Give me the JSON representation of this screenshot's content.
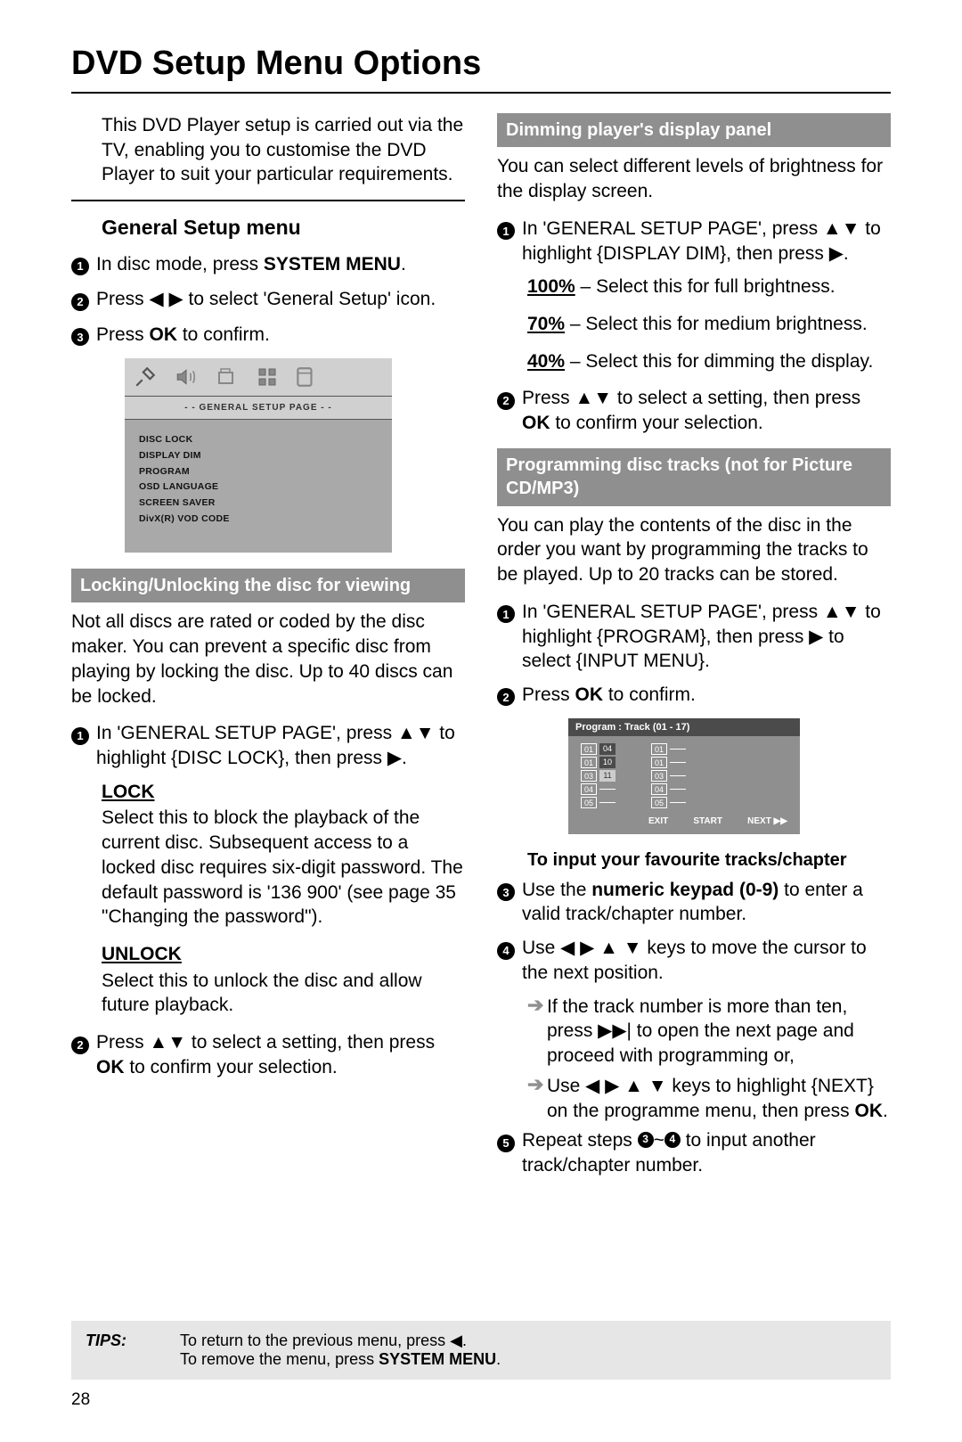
{
  "page_title": "DVD Setup Menu Options",
  "page_number": "28",
  "intro": "This DVD Player setup is carried out via the TV, enabling you to customise the DVD Player to suit your particular requirements.",
  "general_setup_heading": "General Setup menu",
  "gs_steps": {
    "s1a": "In disc mode, press ",
    "s1b": "SYSTEM MENU",
    "s1c": ".",
    "s2a": "Press ",
    "s2b": "◀ ▶",
    "s2c": " to select 'General Setup' icon.",
    "s3a": "Press ",
    "s3b": "OK",
    "s3c": " to confirm."
  },
  "osd1": {
    "header": "- -  GENERAL  SETUP  PAGE  - -",
    "items": [
      "DISC LOCK",
      "DISPLAY DIM",
      "PROGRAM",
      "OSD LANGUAGE",
      "SCREEN SAVER",
      "DivX(R) VOD CODE"
    ]
  },
  "locking": {
    "heading": "Locking/Unlocking the disc for viewing",
    "intro": "Not all discs are rated or coded by the disc maker.  You can prevent a specific disc from playing by locking the disc.  Up to 40 discs can be locked.",
    "s1": "In 'GENERAL SETUP PAGE', press ▲▼ to highlight {DISC LOCK}, then press ▶.",
    "lock_label": "LOCK",
    "lock_text": "Select this to block the playback of the current disc.  Subsequent access to a locked disc requires six-digit password.  The default password is '136 900' (see page 35 \"Changing the password\").",
    "unlock_label": "UNLOCK",
    "unlock_text": "Select this to unlock the disc and allow future playback.",
    "s2a": "Press ▲▼  to select a setting, then press ",
    "s2b": "OK",
    "s2c": " to confirm your selection."
  },
  "dimming": {
    "heading": "Dimming player's display panel",
    "intro": "You can select different levels of brightness for the display screen.",
    "s1": "In 'GENERAL SETUP PAGE', press ▲▼ to highlight {DISPLAY DIM}, then press ▶.",
    "opt100a": "100%",
    "opt100b": " – Select this for full brightness.",
    "opt70a": "70%",
    "opt70b": " – Select this for medium brightness.",
    "opt40a": "40%",
    "opt40b": " – Select this for dimming the display.",
    "s2a": "Press ▲▼  to select a setting, then press ",
    "s2b": "OK",
    "s2c": " to confirm your selection."
  },
  "programming": {
    "heading": "Programming disc tracks (not for Picture CD/MP3)",
    "intro": "You can play the contents of the disc in the order you want by programming the tracks to be played. Up to 20 tracks can be stored.",
    "s1": "In 'GENERAL SETUP PAGE', press ▲▼ to highlight {PROGRAM}, then press ▶  to select {INPUT MENU}.",
    "s2a": "Press ",
    "s2b": "OK",
    "s2c": " to confirm.",
    "osd_title": "Program : Track (01 - 17)",
    "osd_left": [
      {
        "n": "01",
        "v": "04"
      },
      {
        "n": "01",
        "v": "10"
      },
      {
        "n": "03",
        "v": "11",
        "hl": true
      },
      {
        "n": "04",
        "v": ""
      },
      {
        "n": "05",
        "v": ""
      }
    ],
    "osd_right": [
      {
        "n": "01",
        "v": ""
      },
      {
        "n": "01",
        "v": ""
      },
      {
        "n": "03",
        "v": ""
      },
      {
        "n": "04",
        "v": ""
      },
      {
        "n": "05",
        "v": ""
      }
    ],
    "osd_footer": [
      "EXIT",
      "START",
      "NEXT ▶▶"
    ],
    "input_head": "To input your favourite tracks/chapter",
    "s3a": "Use the ",
    "s3b": "numeric keypad (0-9)",
    "s3c": " to enter a valid track/chapter number.",
    "s4": "Use ◀ ▶ ▲ ▼ keys to move the cursor to the next position.",
    "s4sub1": "If the track number is more than ten, press  ▶▶|  to open the next page and proceed with programming or,",
    "s4sub2a": "Use ◀ ▶ ▲ ▼ keys to highlight {NEXT} on the programme menu, then press ",
    "s4sub2b": "OK",
    "s4sub2c": ".",
    "s5a": "Repeat steps ",
    "s5b": "~",
    "s5c": " to input another track/chapter number."
  },
  "tips": {
    "label": "TIPS:",
    "line1": "To return to the previous menu, press ◀.",
    "line2a": "To remove the menu, press ",
    "line2b": "SYSTEM MENU",
    "line2c": "."
  }
}
